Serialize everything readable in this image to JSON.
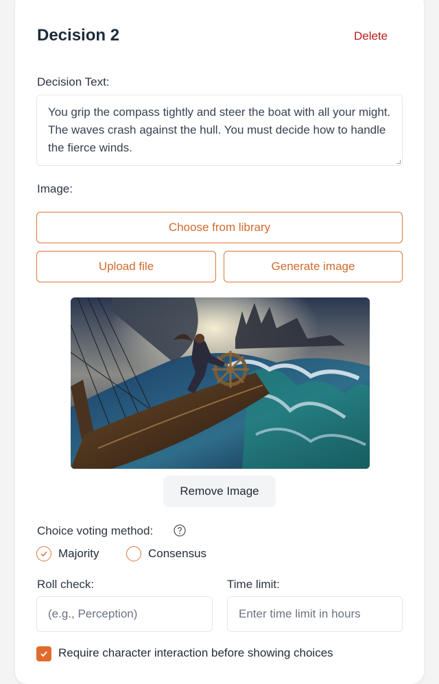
{
  "decision": {
    "title": "Decision 2",
    "delete_label": "Delete",
    "text_label": "Decision Text:",
    "text_value": "You grip the compass tightly and steer the boat with all your might. The waves crash against the hull. You must decide how to handle the fierce winds."
  },
  "image": {
    "label": "Image:",
    "choose_label": "Choose from library",
    "upload_label": "Upload file",
    "generate_label": "Generate image",
    "remove_label": "Remove Image"
  },
  "voting": {
    "label": "Choice voting method:",
    "options": [
      {
        "label": "Majority",
        "selected": true
      },
      {
        "label": "Consensus",
        "selected": false
      }
    ]
  },
  "roll_check": {
    "label": "Roll check:",
    "placeholder": "(e.g., Perception)"
  },
  "time_limit": {
    "label": "Time limit:",
    "placeholder": "Enter time limit in hours"
  },
  "require_interaction": {
    "label": "Require character interaction before showing choices",
    "checked": true
  },
  "colors": {
    "accent": "#d9773b",
    "delete": "#b91c1c"
  }
}
